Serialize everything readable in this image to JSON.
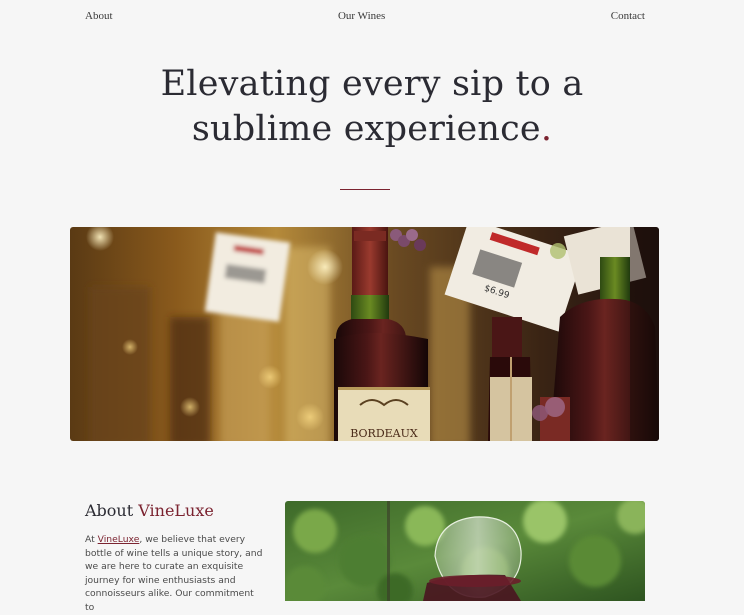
{
  "nav": {
    "about": "About",
    "our_wines": "Our Wines",
    "contact": "Contact"
  },
  "hero": {
    "title_line1": "Elevating every sip to a",
    "title_line2": "sublime experience",
    "title_dot": ".",
    "image_label": "BORDEAUX",
    "price_tag": "$6.99"
  },
  "about": {
    "title_prefix": "About ",
    "title_brand": "VineLuxe",
    "text_prefix": "At ",
    "text_brand_link": "VineLuxe",
    "text_body": ", we believe that every bottle of wine tells a unique story, and we are here to curate an exquisite journey for wine enthusiasts and connoisseurs alike. Our commitment to"
  },
  "colors": {
    "accent": "#7b2330",
    "background": "#f6f6f6",
    "text": "#2b2b33"
  }
}
